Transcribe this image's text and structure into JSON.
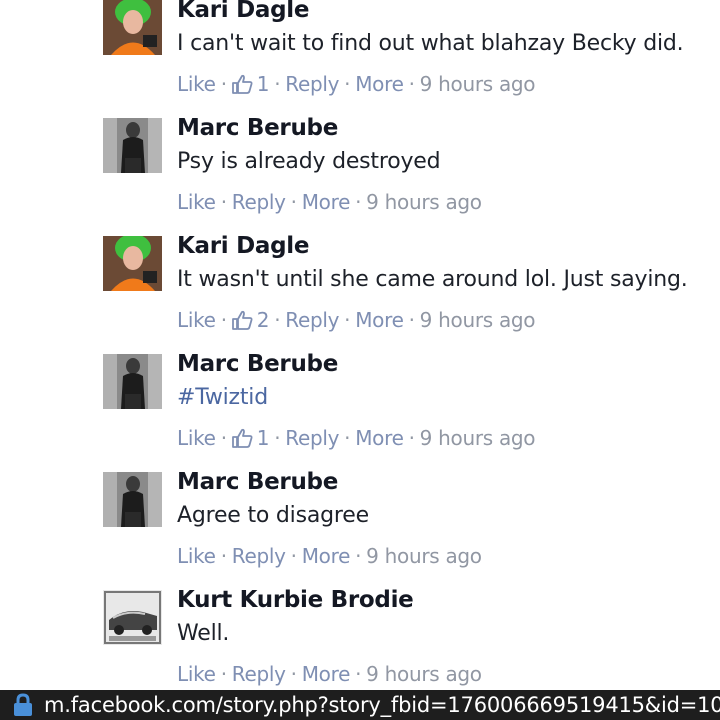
{
  "comments": [
    {
      "author": "Kari Dagle",
      "text": "I can't wait to find out what blahzay Becky did.",
      "like": "Like",
      "like_count": "1",
      "reply": "Reply",
      "more": "More",
      "time": "9 hours ago"
    },
    {
      "author": "Marc Berube",
      "text": "Psy is already destroyed",
      "like": "Like",
      "reply": "Reply",
      "more": "More",
      "time": "9 hours ago"
    },
    {
      "author": "Kari Dagle",
      "text": "It wasn't until she came around lol. Just saying.",
      "like": "Like",
      "like_count": "2",
      "reply": "Reply",
      "more": "More",
      "time": "9 hours ago"
    },
    {
      "author": "Marc Berube",
      "text": "#Twiztid",
      "like": "Like",
      "like_count": "1",
      "reply": "Reply",
      "more": "More",
      "time": "9 hours ago"
    },
    {
      "author": "Marc Berube",
      "text": "Agree to disagree",
      "like": "Like",
      "reply": "Reply",
      "more": "More",
      "time": "9 hours ago"
    },
    {
      "author": "Kurt Kurbie Brodie",
      "text": "Well.",
      "like": "Like",
      "reply": "Reply",
      "more": "More",
      "time": "9 hours ago"
    }
  ],
  "icons": {
    "thumbs_up": "thumbs-up-icon",
    "lock": "lock-icon"
  },
  "colors": {
    "link": "#7f8fb3",
    "hashtag": "#4b67a1",
    "urlbar_bg": "#1e1e1e",
    "lock": "#4a90d9"
  },
  "urlbar": {
    "url": "m.facebook.com/story.php?story_fbid=176006669519415&id=10"
  }
}
